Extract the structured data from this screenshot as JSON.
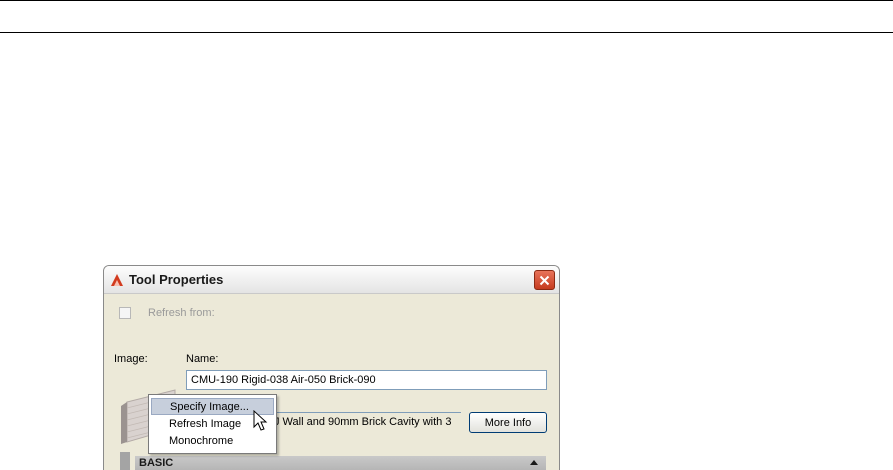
{
  "dialog": {
    "title": "Tool Properties",
    "refresh_label": "Refresh from:",
    "image_label": "Image:",
    "name_label": "Name:",
    "name_value": "CMU-190 Rigid-038 Air-050 Brick-090",
    "description_value": "J Wall and 90mm Brick Cavity with 3",
    "more_info_label": "More Info",
    "section_basic": "BASIC"
  },
  "context_menu": {
    "items": [
      "Specify Image...",
      "Refresh Image",
      "Monochrome"
    ]
  },
  "icons": {
    "app": "autocad-tool-icon",
    "close": "close-icon",
    "collapse": "chevron-up-icon",
    "cursor": "mouse-pointer-icon"
  },
  "colors": {
    "close_button": "#d14a2b",
    "menu_highlight": "#c7cfdc"
  }
}
